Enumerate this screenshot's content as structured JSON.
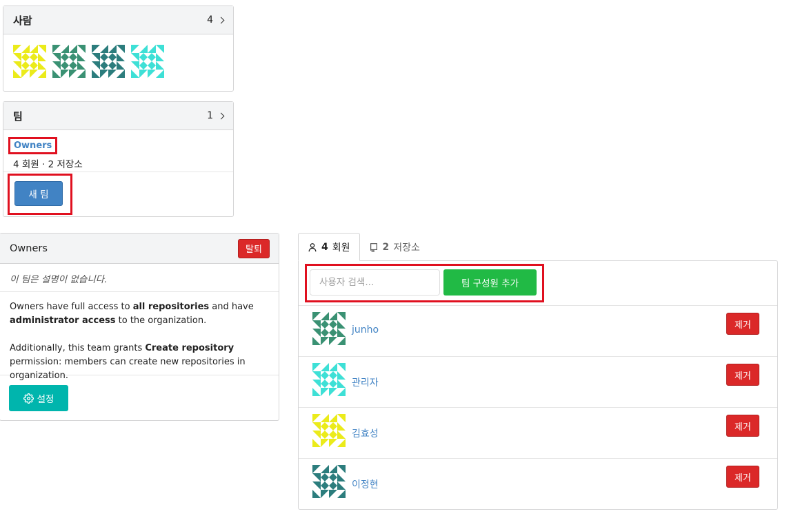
{
  "people": {
    "title": "사람",
    "count": "4",
    "avatars": [
      "yellow-avatar",
      "green-avatar",
      "teal-avatar",
      "cyan-avatar"
    ]
  },
  "teams": {
    "title": "팀",
    "count": "1",
    "team_name": "Owners",
    "team_meta": "4 회원 · 2 저장소",
    "new_team_label": "새 팀"
  },
  "owners": {
    "title": "Owners",
    "leave_label": "탈퇴",
    "no_description": "이 팀은 설명이 없습니다.",
    "access_pre": "Owners have full access to ",
    "access_bold1": "all repositories",
    "access_mid": " and have ",
    "access_bold2": "administrator access",
    "access_post": " to the organization.",
    "perm_pre": "Additionally, this team grants ",
    "perm_bold": "Create repository",
    "perm_post": " permission: members can create new repositories in organization.",
    "settings_label": "설정"
  },
  "tabs": {
    "members_count": "4",
    "members_label": "회원",
    "repos_count": "2",
    "repos_label": "저장소"
  },
  "add_member": {
    "placeholder": "사용자 검색...",
    "button_label": "팀 구성원 추가"
  },
  "members": [
    {
      "name": "junho",
      "avatar": "green",
      "remove_label": "제거"
    },
    {
      "name": "관리자",
      "avatar": "cyan",
      "remove_label": "제거"
    },
    {
      "name": "김효성",
      "avatar": "yellow",
      "remove_label": "제거"
    },
    {
      "name": "이정현",
      "avatar": "teal",
      "remove_label": "제거"
    }
  ],
  "colors": {
    "yellow": "#ebeb1a",
    "green": "#3a9173",
    "teal": "#2c7d7d",
    "cyan": "#3ee0d6",
    "link": "#4183c4",
    "danger": "#db2828",
    "success": "#21ba45",
    "teal_button": "#00b5ad"
  }
}
